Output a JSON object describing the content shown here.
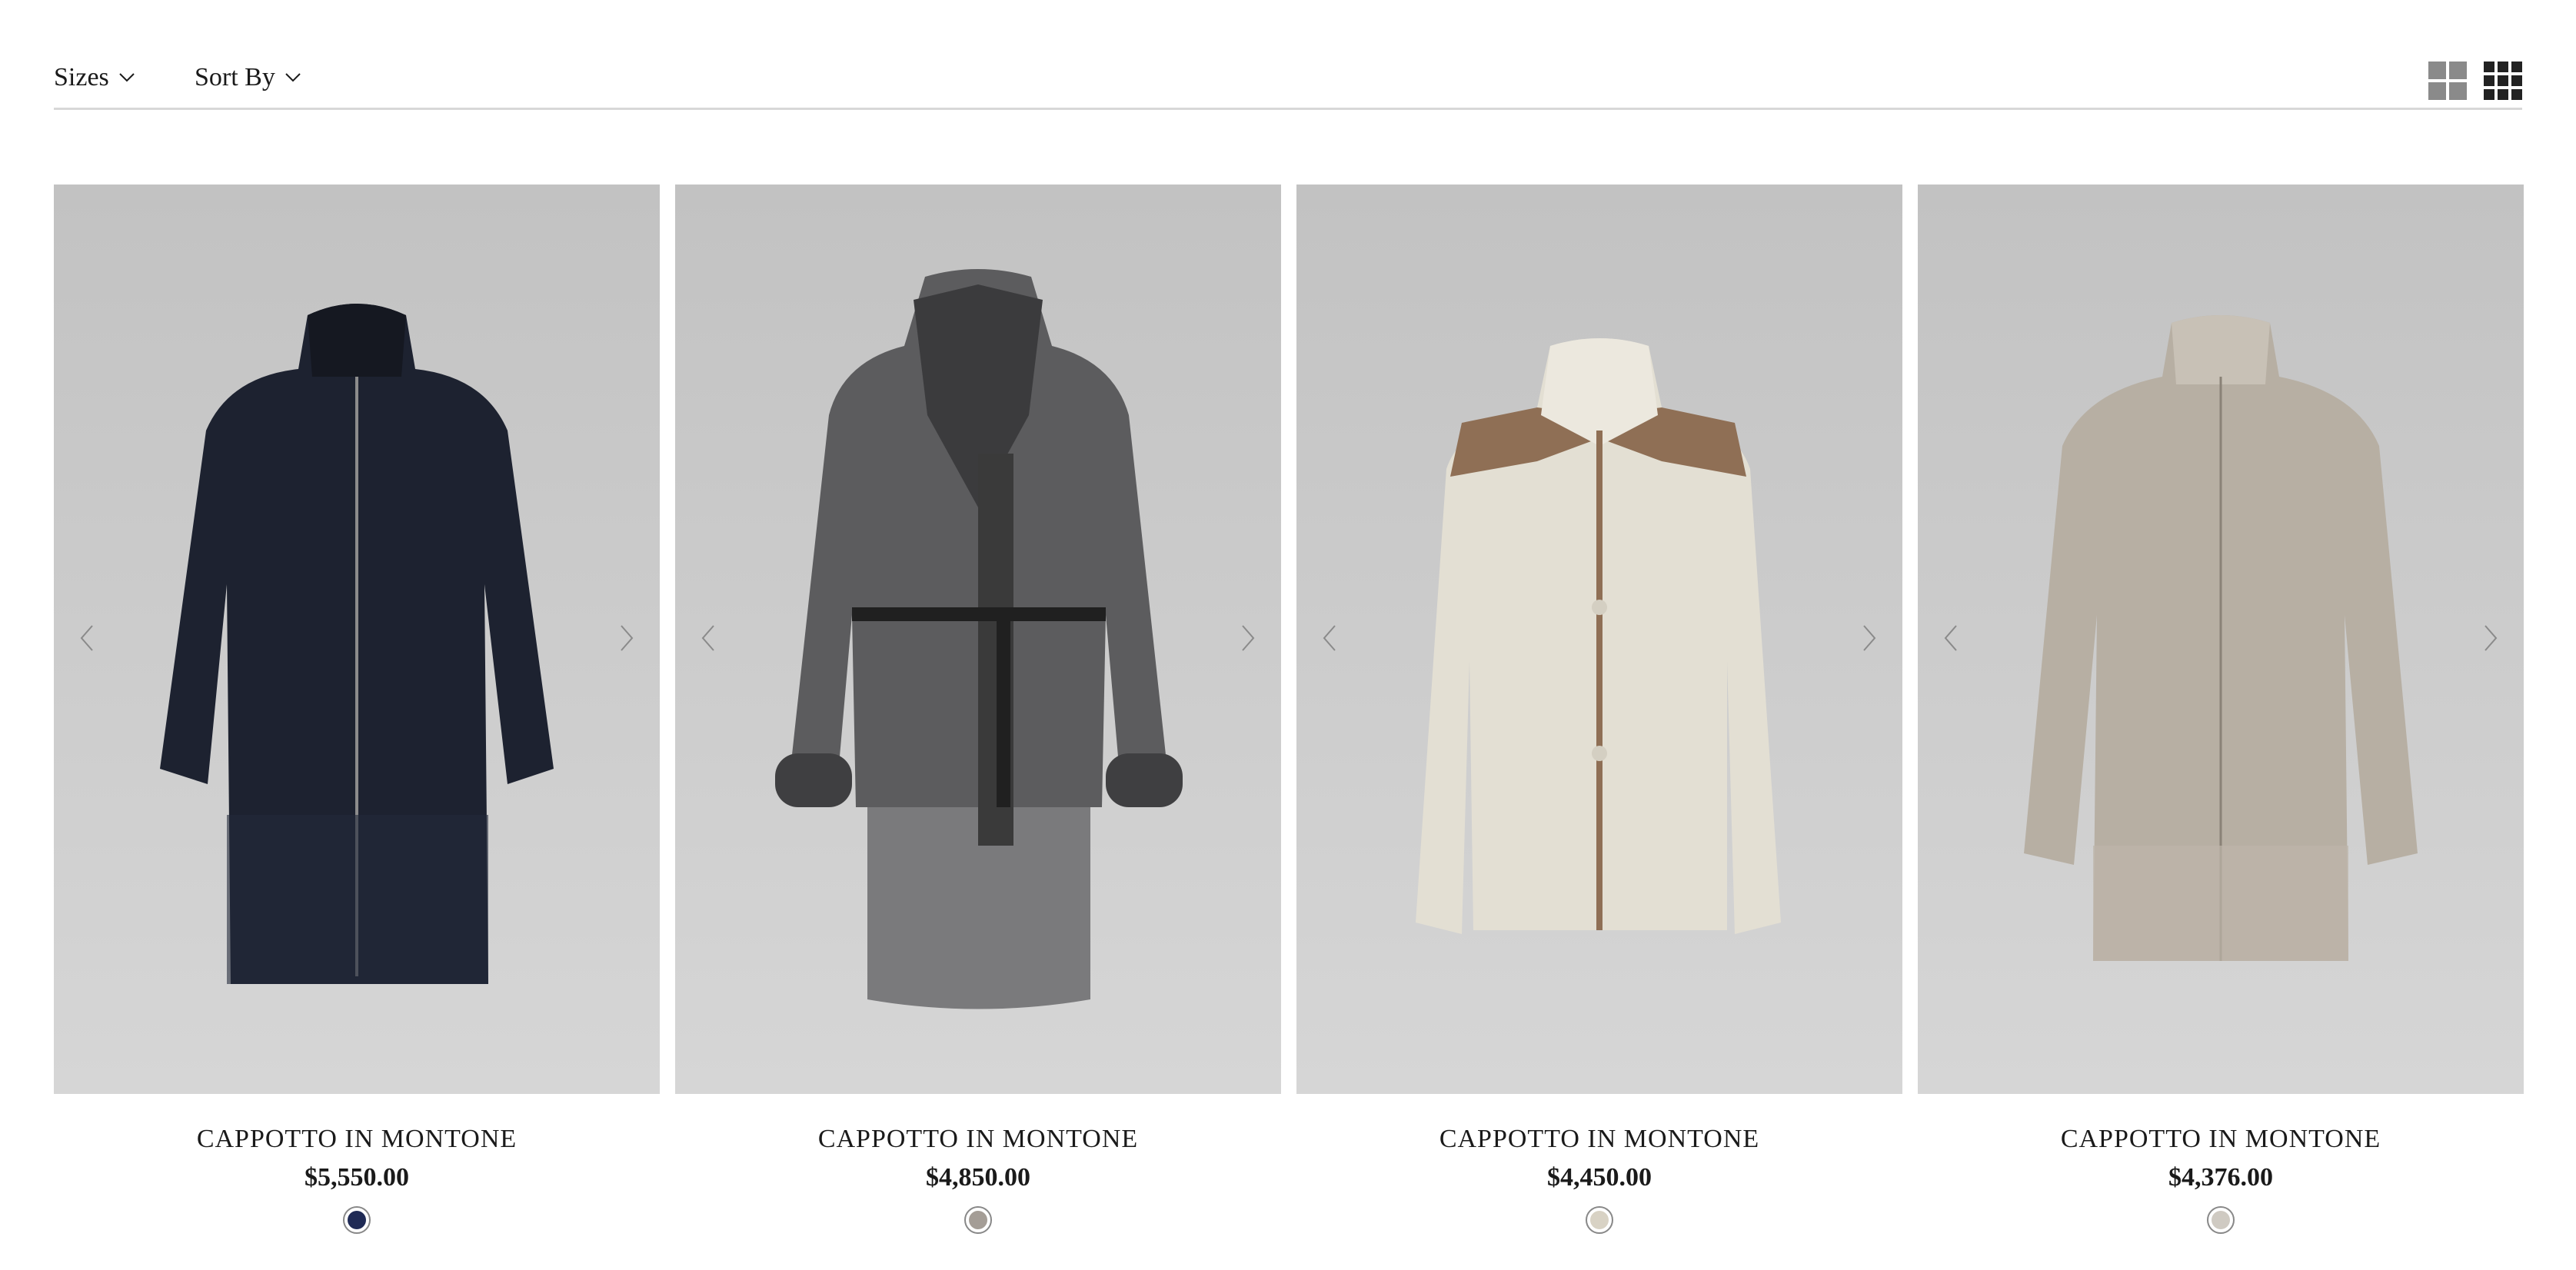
{
  "filters": {
    "sizes_label": "Sizes",
    "sort_label": "Sort By"
  },
  "view_toggles": [
    "grid-2x2-icon",
    "grid-3x3-icon"
  ],
  "products": [
    {
      "name": "CAPPOTTO IN MONTONE",
      "price": "$5,550.00",
      "swatch_color": "#1f2a55",
      "coat_color": "#1d2230"
    },
    {
      "name": "CAPPOTTO IN MONTONE",
      "price": "$4,850.00",
      "swatch_color": "#a49d96",
      "coat_color": "#5c5c5e"
    },
    {
      "name": "CAPPOTTO IN MONTONE",
      "price": "$4,450.00",
      "swatch_color": "#d8d2c4",
      "coat_color": "#e3dfd3"
    },
    {
      "name": "CAPPOTTO IN MONTONE",
      "price": "$4,376.00",
      "swatch_color": "#cfcac2",
      "coat_color": "#b7afa3"
    }
  ],
  "colors": {
    "accent_text": "#1a1a1a",
    "divider": "#d8d8d8",
    "icon_active": "#222222",
    "icon_inactive": "#8a8a8a"
  }
}
